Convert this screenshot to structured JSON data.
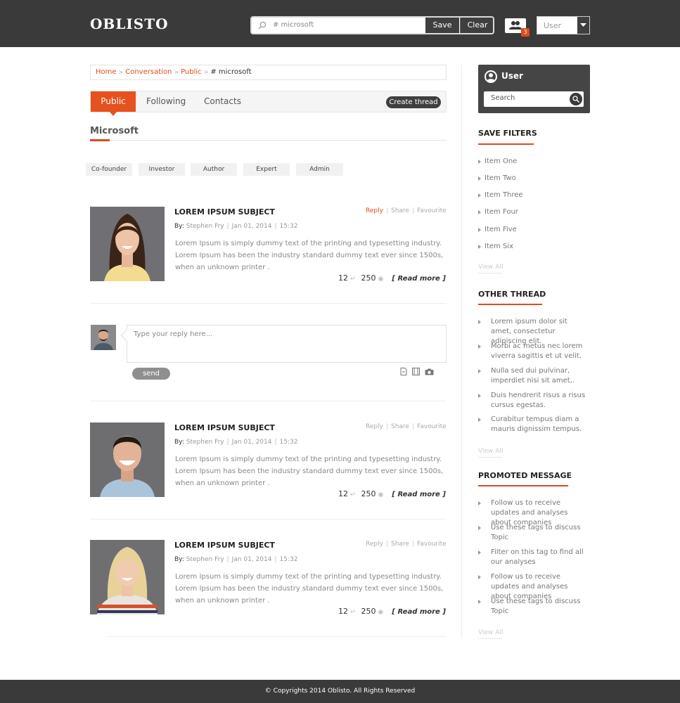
{
  "header": {
    "logo": "OBLISTO",
    "search_query": "# microsoft",
    "save_label": "Save",
    "clear_label": "Clear",
    "notification_count": "3",
    "user_select": "User"
  },
  "breadcrumb": {
    "items": [
      "Home",
      "Conversation",
      "Public"
    ],
    "current": "# microsoft"
  },
  "tabs": {
    "items": [
      "Public",
      "Following",
      "Contacts"
    ],
    "active": "Public",
    "create_label": "Create thread"
  },
  "section_title": "Microsoft",
  "roles": [
    "Co-founder",
    "Investor",
    "Author",
    "Expert",
    "Admin"
  ],
  "posts": [
    {
      "title": "LOREM IPSUM SUBJECT",
      "actions": [
        "Reply",
        "Share",
        "Favourite"
      ],
      "by_label": "By:",
      "author": "Stephen Fry",
      "date": "Jan 01, 2014",
      "time": "15:32",
      "body": "Lorem Ipsum is simply dummy text of the printing and typesetting industry. Lorem Ipsum has been the industry standard dummy text ever since 1500s, when an unknown printer .",
      "replies": "12",
      "views": "250",
      "read_more": "[ Read more ]"
    },
    {
      "title": "LOREM IPSUM SUBJECT",
      "actions": [
        "Reply",
        "Share",
        "Favourite"
      ],
      "by_label": "By:",
      "author": "Stephen Fry",
      "date": "Jan 01, 2014",
      "time": "15:32",
      "body": "Lorem Ipsum is simply dummy text of the printing and typesetting industry. Lorem Ipsum has been the industry standard dummy text ever since 1500s, when an unknown printer .",
      "replies": "12",
      "views": "250",
      "read_more": "[ Read more ]"
    },
    {
      "title": "LOREM IPSUM SUBJECT",
      "actions": [
        "Reply",
        "Share",
        "Favourite"
      ],
      "by_label": "By:",
      "author": "Stephen Fry",
      "date": "Jan 01, 2014",
      "time": "15:32",
      "body": "Lorem Ipsum is simply dummy text of the printing and typesetting industry. Lorem Ipsum has been the industry standard dummy text ever since 1500s, when an unknown printer .",
      "replies": "12",
      "views": "250",
      "read_more": "[ Read more ]"
    }
  ],
  "reply": {
    "placeholder": "Type your reply here...",
    "send_label": "send"
  },
  "sidebar": {
    "user_name": "User",
    "search_placeholder": "Search",
    "save_filters": {
      "title": "SAVE FILTERS",
      "items": [
        "Item One",
        "Item Two",
        "Item Three",
        "Item Four",
        "Item Five",
        "Item Six"
      ],
      "view_all": "View All"
    },
    "other_thread": {
      "title": "OTHER THREAD",
      "items": [
        "Lorem ipsum dolor sit amet, consectetur adipiscing elit.",
        "Morbi ac metus nec lorem viverra sagittis et ut velit.",
        "Nulla sed dui pulvinar, imperdiet nisi sit amet,.",
        "Duis hendrerit risus a risus cursus egestas.",
        "Curabitur tempus diam a mauris dignissim tempus."
      ],
      "view_all": "View All"
    },
    "promoted": {
      "title": "PROMOTED MESSAGE",
      "items": [
        "Follow us to receive updates and analyses about companies",
        "Use these tags to discuss Topic",
        "Filter on this tag to find all our analyses",
        "Follow us to receive updates and analyses about companies",
        "Use these tags to discuss Topic"
      ],
      "view_all": "View All"
    }
  },
  "footer": {
    "text": "© Copyrights 2014 Oblisto. All Rights Reserved"
  },
  "colors": {
    "accent": "#e04b1c",
    "header_bg": "#3a3a3a",
    "dark_button": "#3f3f3f"
  }
}
